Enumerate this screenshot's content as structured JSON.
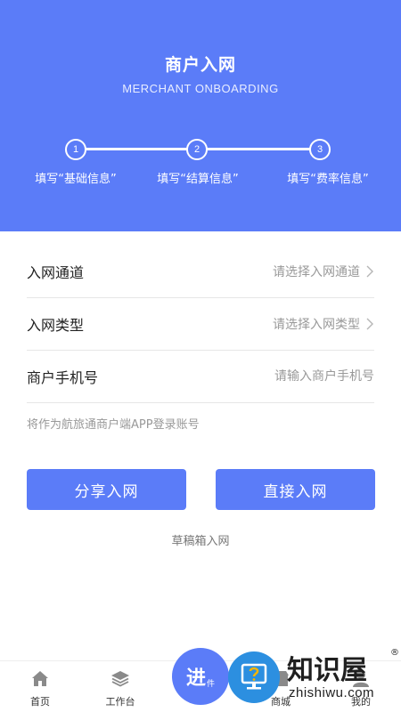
{
  "header": {
    "title": "商户入网",
    "subtitle": "MERCHANT ONBOARDING"
  },
  "steps": [
    {
      "number": "1",
      "label": "填写“基础信息”"
    },
    {
      "number": "2",
      "label": "填写“结算信息”"
    },
    {
      "number": "3",
      "label": "填写“费率信息”"
    }
  ],
  "form": {
    "channel": {
      "label": "入网通道",
      "placeholder": "请选择入网通道"
    },
    "type": {
      "label": "入网类型",
      "placeholder": "请选择入网类型"
    },
    "phone": {
      "label": "商户手机号",
      "placeholder": "请输入商户手机号"
    },
    "hint": "将作为航旅通商户端APP登录账号"
  },
  "actions": {
    "share_label": "分享入网",
    "direct_label": "直接入网",
    "draft_label": "草稿箱入网"
  },
  "tabbar": {
    "home": "首页",
    "workbench": "工作台",
    "mall": "商城",
    "mine": "我的"
  },
  "fab": {
    "main": "进",
    "sub": "件"
  },
  "watermark": {
    "big": "知识屋",
    "small": "zhishiwu.com",
    "mark": "®"
  },
  "colors": {
    "accent": "#5b7cf8"
  }
}
